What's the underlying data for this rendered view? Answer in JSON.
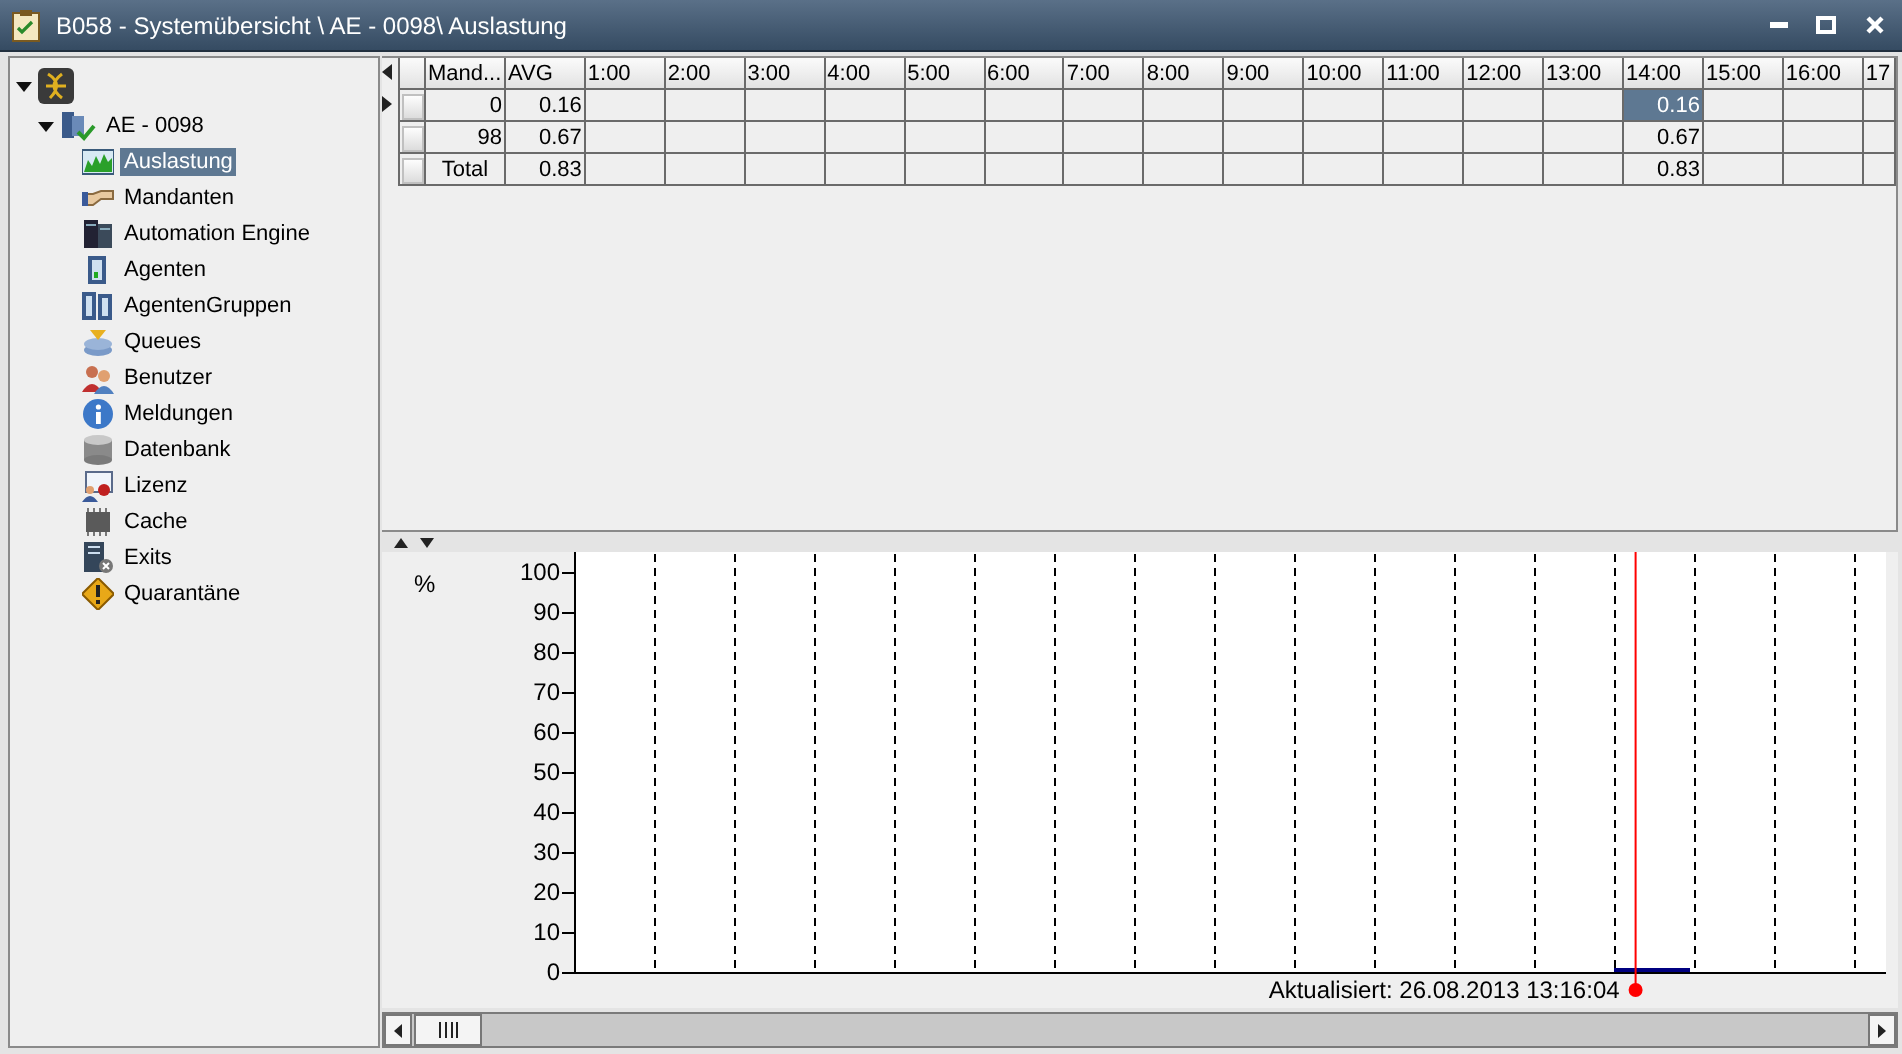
{
  "window": {
    "title": "B058 - Systemübersicht \\ AE - 0098\\ Auslastung"
  },
  "tree": {
    "items": [
      {
        "expanded": true,
        "children": [
          {
            "label": "AE - 0098",
            "expanded": true,
            "children": [
              {
                "label": "Auslastung",
                "selected": true
              },
              {
                "label": "Mandanten",
                "selected": false
              },
              {
                "label": "Automation Engine",
                "selected": false
              },
              {
                "label": "Agenten",
                "selected": false
              },
              {
                "label": "AgentenGruppen",
                "selected": false
              },
              {
                "label": "Queues",
                "selected": false
              },
              {
                "label": "Benutzer",
                "selected": false
              },
              {
                "label": "Meldungen",
                "selected": false
              },
              {
                "label": "Datenbank",
                "selected": false
              },
              {
                "label": "Lizenz",
                "selected": false
              },
              {
                "label": "Cache",
                "selected": false
              },
              {
                "label": "Exits",
                "selected": false
              },
              {
                "label": "Quarantäne",
                "selected": false
              }
            ]
          }
        ]
      }
    ]
  },
  "table": {
    "columns": [
      "Mand...",
      "AVG",
      "1:00",
      "2:00",
      "3:00",
      "4:00",
      "5:00",
      "6:00",
      "7:00",
      "8:00",
      "9:00",
      "10:00",
      "11:00",
      "12:00",
      "13:00",
      "14:00",
      "15:00",
      "16:00",
      "17"
    ],
    "rows": [
      {
        "kind": "data",
        "current": true,
        "cells": [
          {
            "text": "0",
            "selected": false
          },
          {
            "text": "0.16",
            "selected": false
          },
          null,
          null,
          null,
          null,
          null,
          null,
          null,
          null,
          null,
          null,
          null,
          null,
          null,
          {
            "text": "0.16",
            "selected": true
          },
          null,
          null,
          null
        ]
      },
      {
        "kind": "data",
        "current": false,
        "cells": [
          {
            "text": "98",
            "selected": false
          },
          {
            "text": "0.67",
            "selected": false
          },
          null,
          null,
          null,
          null,
          null,
          null,
          null,
          null,
          null,
          null,
          null,
          null,
          null,
          {
            "text": "0.67",
            "selected": false
          },
          null,
          null,
          null
        ]
      },
      {
        "kind": "total",
        "current": false,
        "cells": [
          {
            "text": "Total",
            "selected": false
          },
          {
            "text": "0.83",
            "selected": false
          },
          null,
          null,
          null,
          null,
          null,
          null,
          null,
          null,
          null,
          null,
          null,
          null,
          null,
          {
            "text": "0.83",
            "selected": false
          },
          null,
          null,
          null
        ]
      }
    ]
  },
  "chart": {
    "chart_data": {
      "type": "bar",
      "ylabel": "%",
      "categories": [
        null,
        null,
        null,
        null,
        null,
        null,
        null,
        null,
        null,
        null,
        null,
        null,
        null,
        null,
        null,
        null
      ],
      "series": [
        {
          "color": "#000080",
          "values": [
            null,
            null,
            null,
            null,
            null,
            null,
            null,
            null,
            null,
            null,
            null,
            null,
            null,
            0.5,
            null,
            null
          ]
        }
      ],
      "ylim": [
        0,
        105
      ],
      "yticks": [
        0,
        10,
        20,
        30,
        40,
        50,
        60,
        70,
        80,
        90,
        100
      ]
    },
    "updated": "Aktualisiert: 26.08.2013 13:16:04"
  }
}
